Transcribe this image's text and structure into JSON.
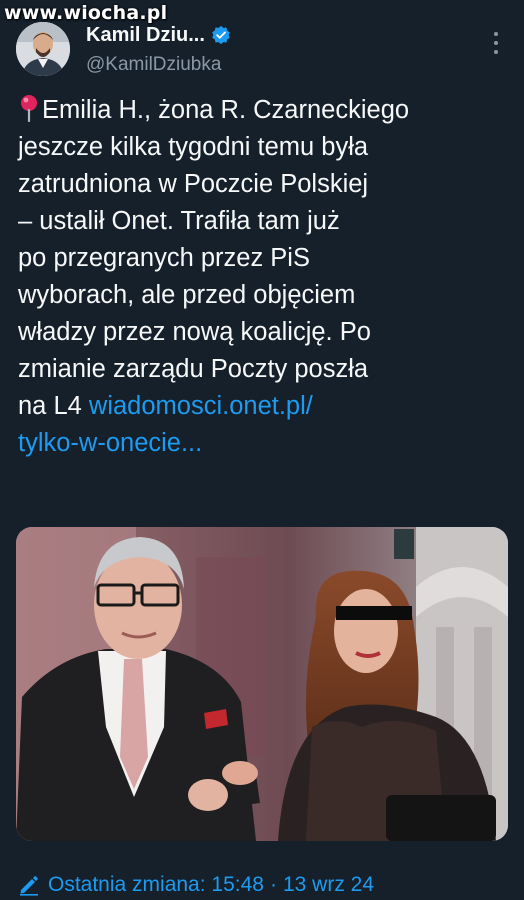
{
  "watermark": "www.wiocha.pl",
  "author": {
    "display_name": "Kamil Dziu...",
    "handle": "@KamilDziubka",
    "avatar_icon": "person-avatar-icon",
    "verified_icon": "verified-badge-icon"
  },
  "tweet": {
    "pin_icon": "round-pushpin-icon",
    "text": "Emilia H., żona R. Czarneckiego\njeszcze kilka tygodni temu była\nzatrudniona w Poczcie Polskiej\n– ustalił Onet. Trafiła tam już\npo przegranych przez PiS\nwyborach, ale przed objęciem\nwładzy przez nową koalicję. Po\nzmianie zarządu Poczty poszła\nna L4 ",
    "link_line1": "wiadomosci.onet.pl/",
    "link_line2": "tylko-w-onecie..."
  },
  "media": {
    "description_icon": "photo-icon"
  },
  "footer": {
    "edit_icon": "pencil-icon",
    "edited_label": "Ostatnia zmiana: 15:48",
    "separator": "·",
    "date": "13 wrz 24"
  },
  "colors": {
    "background": "#15202b",
    "text": "#f7f9f9",
    "secondary": "#8b98a5",
    "accent": "#1d9bf0"
  }
}
